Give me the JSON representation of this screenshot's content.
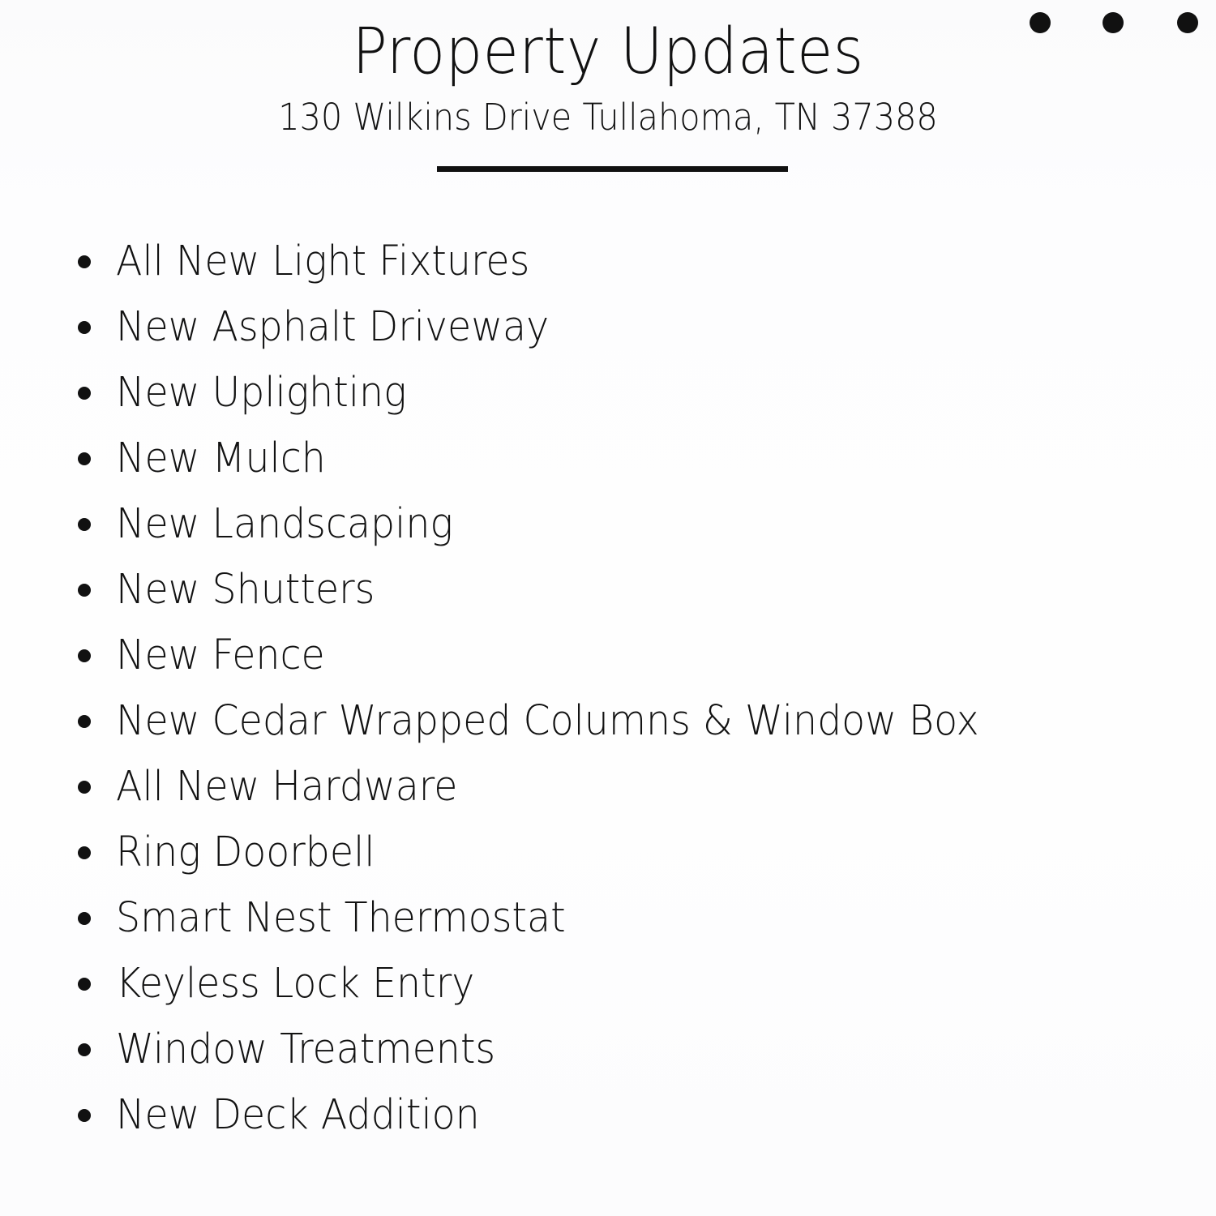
{
  "document": {
    "title": "Property Updates",
    "subtitle": "130 Wilkins Drive Tullahoma, TN 37388",
    "accent_color": "#111111",
    "background_color": "#fdfdfe",
    "text_color": "#121212"
  },
  "decoration": {
    "dots": [
      {
        "name": "dot-1"
      },
      {
        "name": "dot-2"
      },
      {
        "name": "dot-3"
      }
    ]
  },
  "updates": [
    {
      "label": "All New Light Fixtures"
    },
    {
      "label": "New Asphalt Driveway"
    },
    {
      "label": "New Uplighting"
    },
    {
      "label": "New Mulch"
    },
    {
      "label": "New Landscaping"
    },
    {
      "label": "New Shutters"
    },
    {
      "label": "New Fence"
    },
    {
      "label": "New Cedar Wrapped Columns & Window Box"
    },
    {
      "label": "All New Hardware"
    },
    {
      "label": "Ring Doorbell"
    },
    {
      "label": "Smart Nest Thermostat"
    },
    {
      "label": "Keyless Lock Entry"
    },
    {
      "label": "Window Treatments"
    },
    {
      "label": "New Deck Addition"
    }
  ]
}
